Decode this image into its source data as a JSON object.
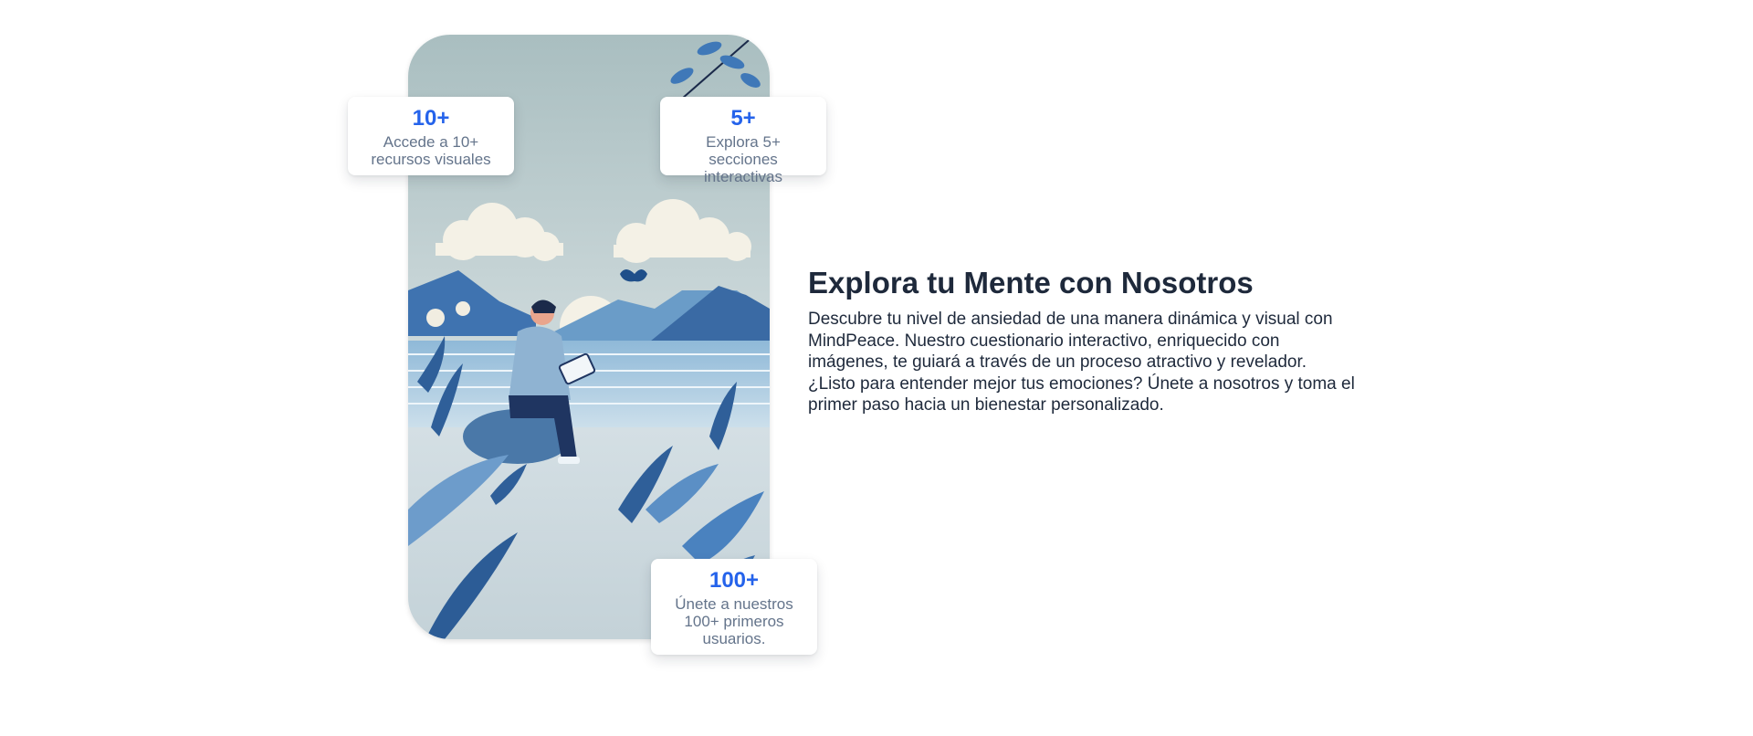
{
  "hero": {
    "image_alt": "Ilustración de una persona leyendo una tableta junto a un lago con montañas y plantas",
    "title": "Explora tu Mente con Nosotros",
    "description": "Descubre tu nivel de ansiedad de una manera dinámica y visual con MindPeace. Nuestro cuestionario interactivo, enriquecido con imágenes, te guiará a través de un proceso atractivo y revelador. ¿Listo para entender mejor tus emociones? Únete a nosotros y toma el primer paso hacia un bienestar personalizado."
  },
  "stats": [
    {
      "value": "10+",
      "caption": "Accede a 10+ recursos visuales"
    },
    {
      "value": "5+",
      "caption": "Explora 5+ secciones interactivas"
    },
    {
      "value": "100+",
      "caption": "Únete a nuestros 100+ primeros usuarios."
    }
  ],
  "colors": {
    "accent": "#2563eb",
    "heading": "#1e293b",
    "muted": "#64748b"
  }
}
